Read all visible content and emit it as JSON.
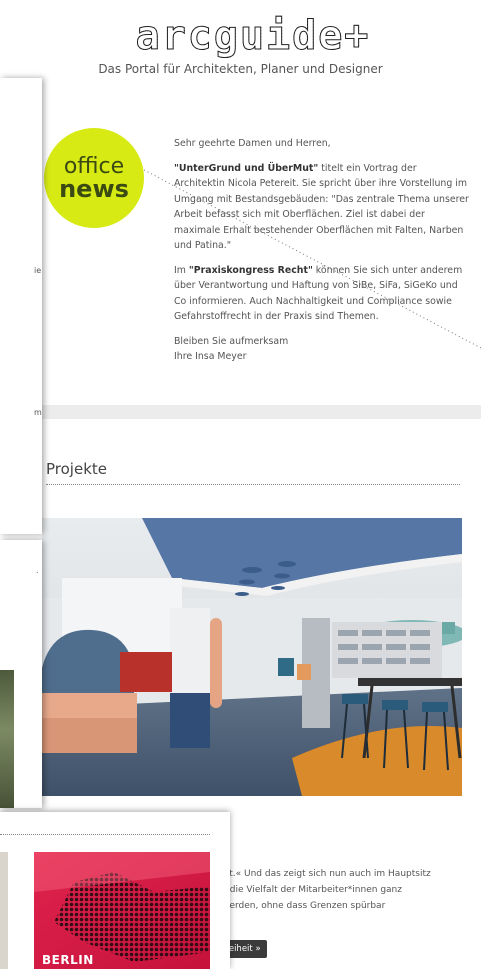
{
  "header": {
    "logo_text": "arcguide+",
    "tagline": "Das Portal für Architekten, Planer und Designer"
  },
  "badge": {
    "line1": "office",
    "line2": "news"
  },
  "body": {
    "greeting": "Sehr geehrte Damen und Herren,",
    "para1_bold": "\"UnterGrund und ÜberMut\"",
    "para1_rest": " titelt ein Vortrag der Architektin Nicola Petereit. Sie spricht über ihre Vorstellung im Umgang mit Bestandsgebäuden: \"Das zentrale Thema unserer Arbeit befasst sich mit Oberflächen. Ziel ist dabei der maximale Erhalt bestehender Oberflächen mit Falten, Narben und Patina.\"",
    "para2_prefix": "Im ",
    "para2_bold": "\"Praxiskongress Recht\"",
    "para2_rest": " können Sie sich unter anderem über Verantwortung und Haftung von SiBe, SiFa, SiGeKo und Co informieren. Auch Nachhaltigkeit und Compliance sowie Gefahrstoffrecht in der Praxis sind Themen.",
    "closing1": "Bleiben Sie aufmerksam",
    "closing2": "Ihre Insa Meyer"
  },
  "section": {
    "title": "Projekte"
  },
  "tease": {
    "line1": "vinnt.« Und das zeigt sich nun auch im Hauptsitz",
    "line2": "ann die Vielfalt der Mitarbeiter*innen ganz",
    "line3": "bt werden, ohne dass Grenzen spürbar",
    "button": "refreiheit »"
  },
  "left_panel": {
    "frag1": "ie",
    "frag2": "m",
    "frag3": "."
  },
  "bottom_card": {
    "image_label": "BERLIN"
  },
  "colors": {
    "badge": "#d7ea14",
    "button": "#3b3b3b",
    "band": "#ececec"
  }
}
